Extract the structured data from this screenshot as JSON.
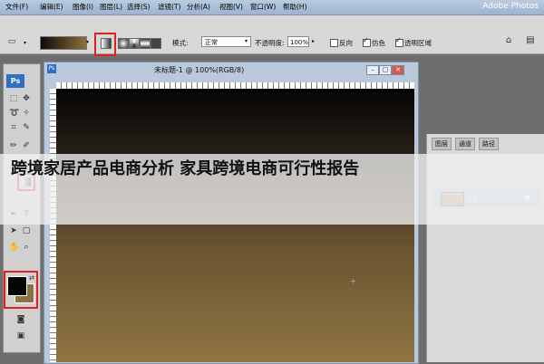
{
  "app": {
    "title": "Adobe Photos"
  },
  "menu": [
    "文件(F)",
    "编辑(E)",
    "图像(I)",
    "图层(L)",
    "选择(S)",
    "滤镜(T)",
    "分析(A)",
    "视图(V)",
    "窗口(W)",
    "帮助(H)"
  ],
  "options_bar": {
    "mode_label": "模式:",
    "mode_value": "正常",
    "opacity_label": "不透明度:",
    "opacity_value": "100%",
    "reverse_label": "反向",
    "dither_label": "仿色",
    "transparency_label": "透明区域"
  },
  "toolbox": {
    "logo": "Ps"
  },
  "document": {
    "title": "未标题-1 @ 100%(RGB/8)"
  },
  "layers_panel": {
    "tabs": [
      "图层",
      "通道",
      "路径"
    ],
    "layer_name": "背景"
  },
  "banner": {
    "title": "跨境家居产品电商分析 家具跨境电商可行性报告"
  },
  "colors": {
    "foreground": "#050505",
    "background": "#8c7240",
    "highlight": "#e02020"
  }
}
